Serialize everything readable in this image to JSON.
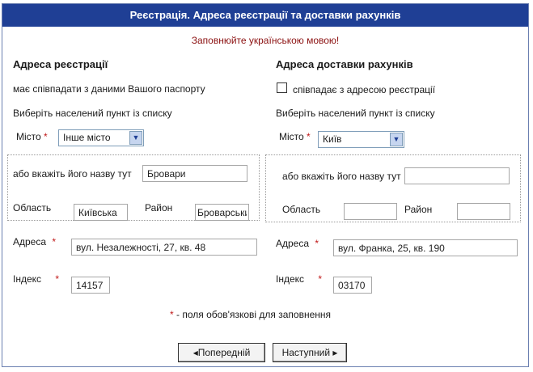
{
  "header": {
    "title": "Реєстрація. Адреса реєстрації та доставки рахунків"
  },
  "notice": "Заповнюйте українською мовою!",
  "registration": {
    "title": "Адреса реєстрації",
    "passport_note": "має співпадати з даними Вашого паспорту",
    "choose_label": "Виберіть населений пункт із списку",
    "city_label": "Місто",
    "city_value": "Інше місто",
    "custom_name_label": "або вкажіть його назву тут",
    "custom_name_value": "Бровари",
    "region_label": "Область",
    "region_value": "Київська",
    "district_label": "Район",
    "district_value": "Броварський",
    "address_label": "Адреса",
    "address_value": "вул. Незалежності, 27, кв. 48",
    "index_label": "Індекс",
    "index_value": "14157"
  },
  "billing": {
    "title": "Адреса доставки рахунків",
    "same_address_label": "співпадає з адресою реєстрації",
    "same_address_checked": false,
    "choose_label": "Виберіть населений пункт із списку",
    "city_label": "Місто",
    "city_value": "Київ",
    "custom_name_label": "або вкажіть його назву тут",
    "custom_name_value": "",
    "region_label": "Область",
    "region_value": "",
    "district_label": "Район",
    "district_value": "",
    "address_label": "Адреса",
    "address_value": "вул. Франка, 25, кв. 190",
    "index_label": "Індекс",
    "index_value": "03170"
  },
  "required_mark": "*",
  "required_note": "- поля обов'язкові для заповнення",
  "nav": {
    "prev_label": "◂Попередній",
    "next_label": "Наступний ▸"
  },
  "colors": {
    "title_bar": "#1f3f95",
    "notice": "#8b1010",
    "required": "#c01818"
  }
}
